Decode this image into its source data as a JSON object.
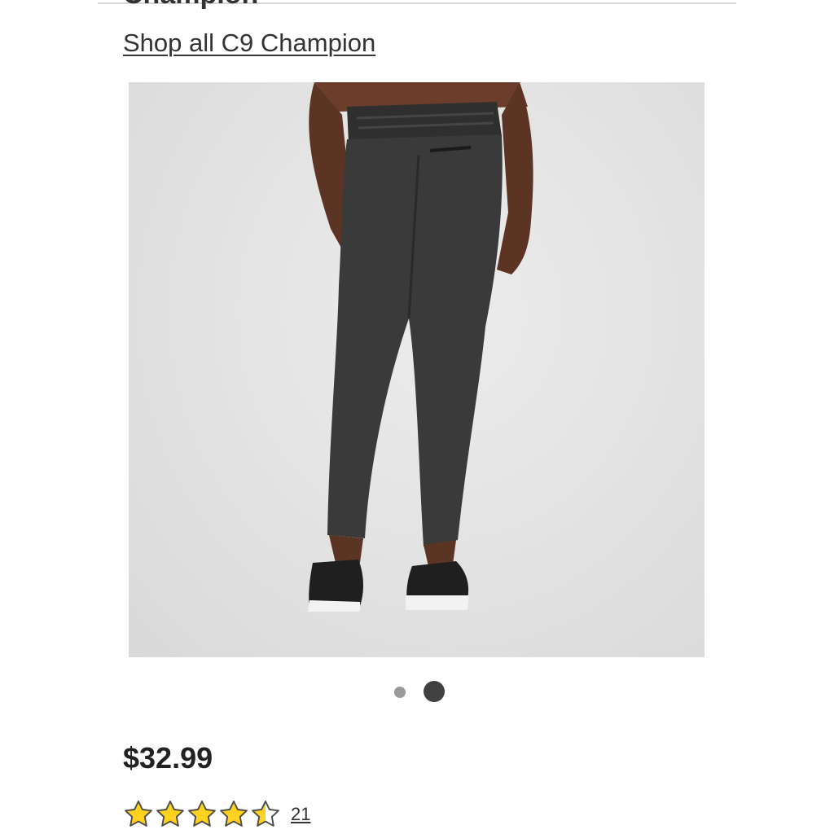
{
  "header": {
    "brand_title": "Champion",
    "shop_all_link": "Shop all C9 Champion"
  },
  "product": {
    "image_count": 2,
    "active_image_index": 2,
    "price": "$32.99",
    "rating_value": 4.5,
    "rating_max": 5,
    "review_count": "21"
  },
  "icons": {
    "favorite": "heart-outline-icon",
    "star": "star-icon"
  },
  "colors": {
    "star_fill": "#FFD21F",
    "star_outline": "#4a4a4a",
    "dot_active": "#404040",
    "dot_inactive": "#9a9a9a"
  }
}
